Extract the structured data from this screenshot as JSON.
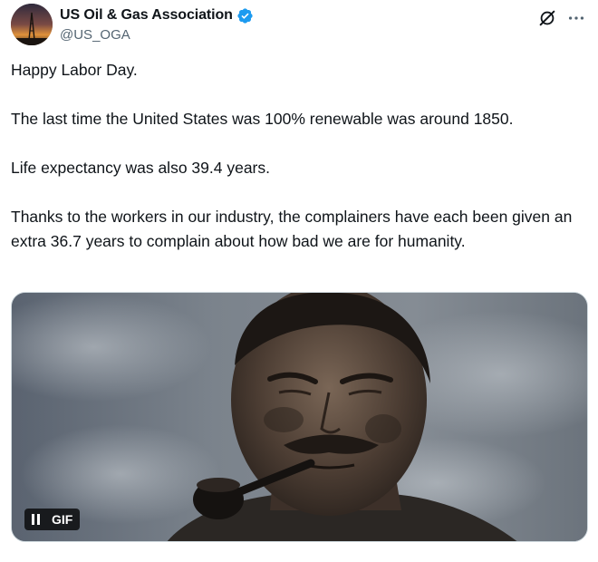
{
  "author": {
    "display_name": "US Oil & Gas Association",
    "handle": "@US_OGA",
    "verified_icon": "verified-badge-icon",
    "verified_color": "#1d9bf0"
  },
  "actions": {
    "grok_icon": "grok-icon",
    "more_icon": "more-icon"
  },
  "tweet": {
    "paragraphs": [
      "Happy Labor Day.",
      "The last time the United States was 100% renewable was around 1850.",
      "Life expectancy was also 39.4 years.",
      "Thanks to the workers in our industry, the complainers have each been given an extra 36.7 years to complain about how bad we are for humanity."
    ]
  },
  "media": {
    "type": "gif",
    "badge_label": "GIF",
    "pause_icon": "pause-icon"
  },
  "colors": {
    "text_primary": "#0f1419",
    "text_secondary": "#536471",
    "border": "#cfd9de"
  }
}
